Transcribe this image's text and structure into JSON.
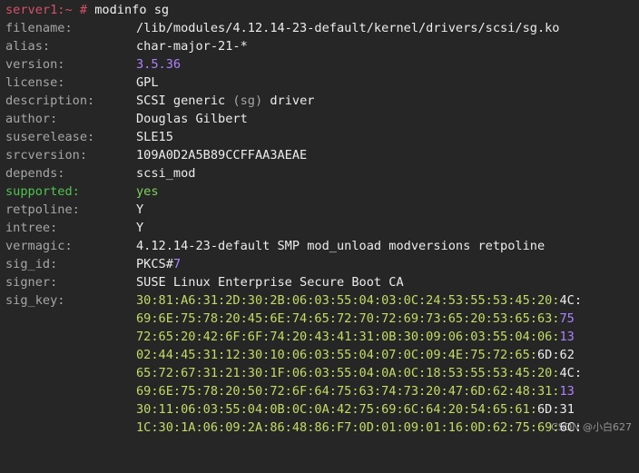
{
  "prompt": {
    "host": "server1:~",
    "symbol": "#",
    "command": "modinfo sg"
  },
  "fields": {
    "filename": {
      "key": "filename:",
      "value": "/lib/modules/4.12.14-23-default/kernel/drivers/scsi/sg.ko"
    },
    "alias": {
      "key": "alias:",
      "value": "char-major-21-*"
    },
    "version": {
      "key": "version:",
      "value": "3.5.36"
    },
    "license": {
      "key": "license:",
      "value": "GPL"
    },
    "description": {
      "key": "description:",
      "value_pre": "SCSI generic ",
      "value_hl": "(sg)",
      "value_post": " driver"
    },
    "author": {
      "key": "author:",
      "value": "Douglas Gilbert"
    },
    "suserelease": {
      "key": "suserelease:",
      "value": "SLE15"
    },
    "srcversion": {
      "key": "srcversion:",
      "value": "109A0D2A5B89CCFFAA3AEAE"
    },
    "depends": {
      "key": "depends:",
      "value": "scsi_mod"
    },
    "supported": {
      "key": "supported:",
      "value": "yes"
    },
    "retpoline": {
      "key": "retpoline:",
      "value": "Y"
    },
    "intree": {
      "key": "intree:",
      "value": "Y"
    },
    "vermagic": {
      "key": "vermagic:",
      "value": "4.12.14-23-default SMP mod_unload modversions retpoline"
    },
    "sig_id": {
      "key": "sig_id:",
      "value_pre": "PKCS#",
      "value_hl": "7"
    },
    "signer": {
      "key": "signer:",
      "value": "SUSE Linux Enterprise Secure Boot CA"
    },
    "sig_key": {
      "key": "sig_key:"
    }
  },
  "sig_key_lines": [
    {
      "main": "30:81:A6:31:2D:30:2B:06:03:55:04:03:0C:24:53:55:53:45:20:",
      "end": "4C:",
      "end_style": "white"
    },
    {
      "main": "69:6E:75:78:20:45:6E:74:65:72:70:72:69:73:65:20:53:65:63:",
      "end": "75",
      "end_style": "purple"
    },
    {
      "main": "72:65:20:42:6F:6F:74:20:43:41:31:0B:30:09:06:03:55:04:06:",
      "end": "13",
      "end_style": "purple"
    },
    {
      "main": "02:44:45:31:12:30:10:06:03:55:04:07:0C:09:4E:75:72:65:",
      "end": "6D:62",
      "end_style": "white_purple"
    },
    {
      "main": "65:72:67:31:21:30:1F:06:03:55:04:0A:0C:18:53:55:53:45:20:",
      "end": "4C:",
      "end_style": "white"
    },
    {
      "main": "69:6E:75:78:20:50:72:6F:64:75:63:74:73:20:47:6D:62:48:31:",
      "end": "13",
      "end_style": "purple"
    },
    {
      "main": "30:11:06:03:55:04:0B:0C:0A:42:75:69:6C:64:20:54:65:61:",
      "end": "6D:31",
      "end_style": "white_purple"
    },
    {
      "main": "1C:30:1A:06:09:2A:86:48:86:F7:0D:01:09:01:16:0D:62:75:69:",
      "end": "6C:",
      "end_style": "white"
    }
  ],
  "watermark": "CSDN @小白627",
  "colors": {
    "background": "#262626",
    "prompt": "#d5516b",
    "label": "#a6a6a6",
    "number_highlight": "#ae81ff",
    "supported_label": "#4fc34f",
    "supported_value": "#7fd35a",
    "hex": "#c2dc62"
  }
}
